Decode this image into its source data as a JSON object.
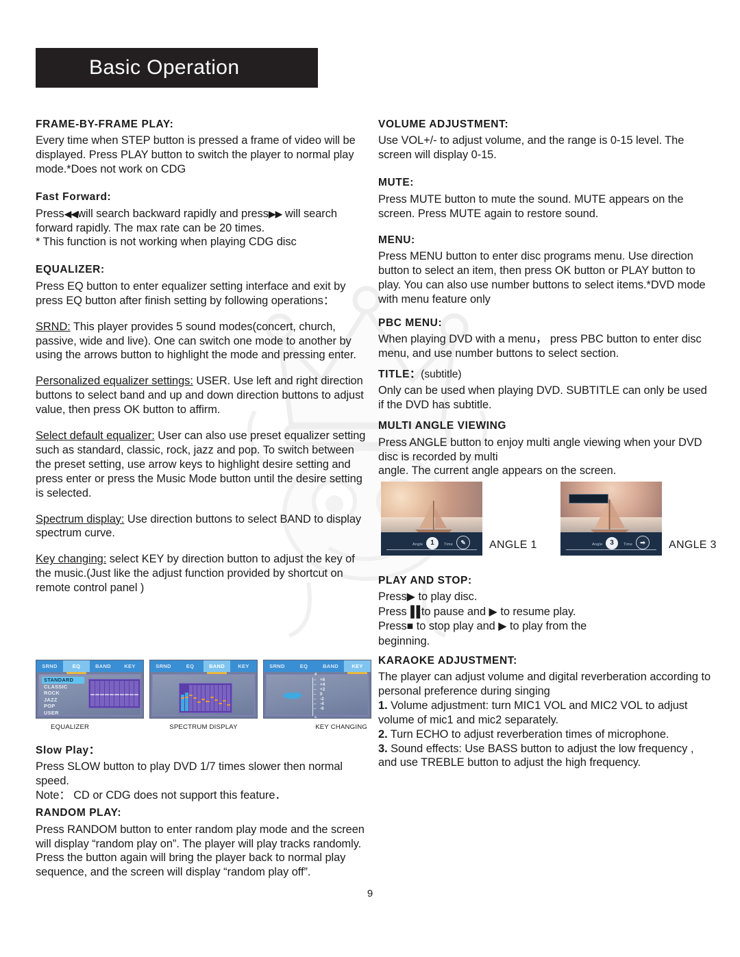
{
  "header": {
    "title": "Basic Operation"
  },
  "page_number": "9",
  "left_column": {
    "sections": [
      {
        "heading": "FRAME-BY-FRAME PLAY:",
        "body": "Every time when STEP button is pressed a frame of video will be displayed. Press PLAY button to switch the player to normal play mode.*Does not work on CDG"
      },
      {
        "heading": "Fast Forward:",
        "body_before": "Press",
        "glyph_back": "◀◀",
        "body_middle": "will search backward rapidly and press",
        "glyph_fwd": "▶▶",
        "body_after": "will search forward rapidly. The max rate can be 20 times.",
        "note": "* This function is not working when playing CDG disc"
      },
      {
        "heading": "EQUALIZER:",
        "body": "Press EQ button to enter equalizer setting interface and exit by press EQ button after finish setting by following operations："
      }
    ],
    "paragraphs": [
      {
        "lead": "SRND:",
        "text": " This player provides 5 sound modes(concert, church, passive, wide and live). One can switch one mode to another by using the arrows button to highlight the mode and pressing enter."
      },
      {
        "lead": "Personalized equalizer settings:",
        "text": " USER. Use left and right direction buttons to select band and up and down direction buttons to adjust value, then press OK button to affirm."
      },
      {
        "lead": "Select default equalizer:",
        "text": " User  can also use preset equalizer  setting such as standard, classic, rock, jazz and pop. To switch between the preset setting, use arrow keys to highlight desire setting and press enter or press the Music Mode button until the desire setting is selected."
      },
      {
        "lead": "Spectrum display:",
        "text": " Use direction buttons to select BAND to display spectrum curve."
      },
      {
        "lead": "Key changing:",
        "text": " select KEY by direction button to adjust the key of the music.(Just like the adjust function provided by shortcut on remote control panel )"
      }
    ],
    "screenshots": [
      {
        "caption": "EQUALIZER",
        "tabs": [
          "SRND",
          "EQ",
          "BAND",
          "KEY"
        ],
        "active_tab": "EQ",
        "list": [
          "STANDARD",
          "CLASSIC",
          "ROCK",
          "JAZZ",
          "POP",
          "USER"
        ],
        "selected": "STANDARD"
      },
      {
        "caption": "SPECTRUM DISPLAY",
        "tabs": [
          "SRND",
          "EQ",
          "BAND",
          "KEY"
        ],
        "active_tab": "BAND"
      },
      {
        "caption": "KEY CHANGING",
        "tabs": [
          "SRND",
          "EQ",
          "BAND",
          "KEY"
        ],
        "active_tab": "KEY",
        "scale": [
          "+6",
          "+4",
          "+2",
          "0",
          "-2",
          "-4",
          "-6"
        ],
        "top_mark": "#",
        "bottom_mark": "b"
      }
    ],
    "slow_play": {
      "heading": "Slow Play：",
      "body": "Press SLOW button to play DVD 1/7 times slower then normal speed.",
      "note": "Note： CD  or   CDG does  not   support   this feature．"
    },
    "random_play": {
      "heading": "RANDOM PLAY:",
      "body": "Press RANDOM button to enter random play mode and the screen will display “random play on”. The player will play tracks randomly. Press the button again will bring the player back to normal play sequence, and the screen will display “random play off”."
    }
  },
  "right_column": {
    "sections": [
      {
        "heading": "VOLUME ADJUSTMENT:",
        "body": "Use VOL+/- to adjust volume, and the range is 0-15 level. The screen will display 0-15."
      },
      {
        "heading": "MUTE:",
        "body": "Press MUTE button to mute the sound. MUTE appears on the screen. Press MUTE again to restore sound."
      },
      {
        "heading": "MENU:",
        "body": "Press MENU button to enter disc programs menu. Use direction button to select an item, then press OK button or PLAY button to play. You can also use number buttons to select items.*DVD mode with menu feature only"
      },
      {
        "heading": "PBC MENU:",
        "body": "When playing DVD with a menu， press PBC button to enter disc menu, and use number buttons to select section."
      },
      {
        "heading": "TITLE：",
        "heading_light": "(subtitle)",
        "body": "Only can be used when playing DVD. SUBTITLE can only be used if the DVD has subtitle."
      },
      {
        "heading": "MULTI ANGLE VIEWING",
        "body": "Press ANGLE button to enjoy multi angle viewing when your DVD disc is recorded by multi",
        "body2": "angle. The current angle appears on the screen."
      }
    ],
    "angle_images": [
      {
        "caption": "ANGLE 1",
        "angle_label": "Angle",
        "angle_value": "1",
        "time_label": "Time"
      },
      {
        "caption": "ANGLE 3",
        "angle_label": "Angle",
        "angle_value": "3",
        "time_label": "Time"
      }
    ],
    "play_and_stop": {
      "heading": "PLAY AND STOP:",
      "line1_a": "Press",
      "glyph_play": "▶",
      "line1_b": "to play disc.",
      "line2_a": "Press",
      "glyph_pause": "▐▐",
      "line2_b": "to pause and",
      "line2_c": "to resume play.",
      "line3_a": "Press",
      "glyph_stop": "■",
      "line3_b": "to stop play and",
      "line3_c": "to play from the",
      "line4": "beginning."
    },
    "karaoke": {
      "heading": "KARAOKE ADJUSTMENT:",
      "body": "The player can adjust volume and digital reverberation according to personal preference during singing",
      "items": [
        {
          "num": "1.",
          "text": " Volume adjustment: turn MIC1 VOL and MIC2 VOL to adjust volume of mic1 and mic2 separately."
        },
        {
          "num": "2.",
          "text": " Turn ECHO to adjust reverberation times of microphone."
        },
        {
          "num": "3.",
          "text": " Sound effects: Use BASS button to adjust the low frequency , and use TREBLE button to adjust the high frequency."
        }
      ]
    }
  },
  "colors": {
    "banner_bg": "#231f20",
    "banner_text": "#ffffff",
    "osd_tab_bg": "#3a8fd4",
    "osd_tab_active": "#7fc4ef",
    "osd_underline": "#e8b93a",
    "osd_select": "#63c3f0",
    "bars": "#5b3fa8"
  }
}
